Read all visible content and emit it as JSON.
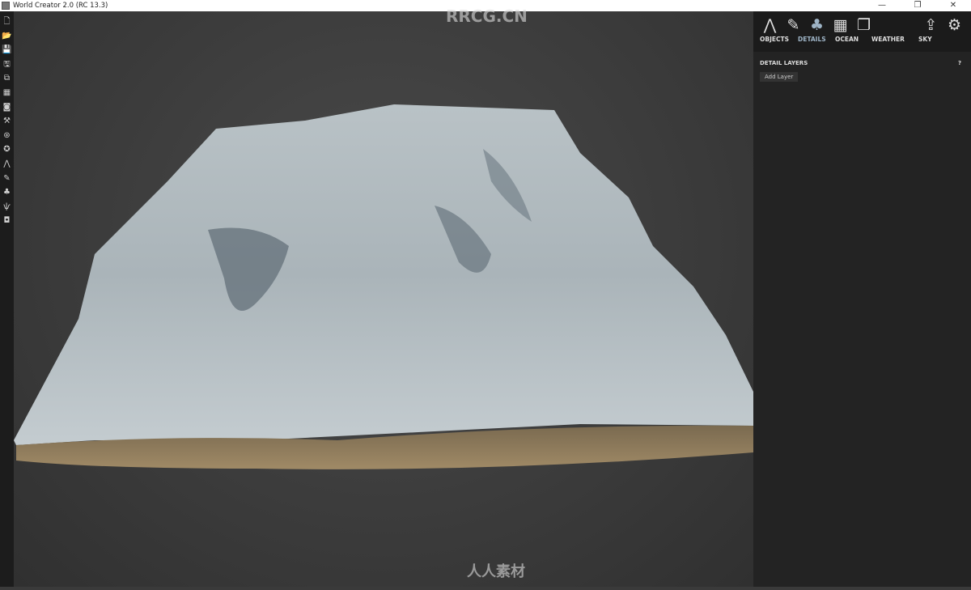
{
  "window": {
    "title": "World Creator 2.0 (RC 13.3)",
    "minimize": "—",
    "restore": "❐",
    "close": "✕"
  },
  "left_toolbar": [
    {
      "icon": "new-file-icon",
      "glyph": "🗋"
    },
    {
      "icon": "open-folder-icon",
      "glyph": "📂"
    },
    {
      "icon": "save-icon",
      "glyph": "💾"
    },
    {
      "icon": "save-as-icon",
      "glyph": "🖫"
    },
    {
      "icon": "import-icon",
      "glyph": "⧉"
    },
    {
      "icon": "map-icon",
      "glyph": "▦"
    },
    {
      "icon": "binoculars-icon",
      "glyph": "◙"
    },
    {
      "icon": "paint-brush-icon",
      "glyph": "⚒"
    },
    {
      "icon": "globe-icon",
      "glyph": "⊛"
    },
    {
      "icon": "star-icon",
      "glyph": "✪"
    },
    {
      "icon": "mountain-icon",
      "glyph": "⋀"
    },
    {
      "icon": "brush-icon",
      "glyph": "✎"
    },
    {
      "icon": "trees-icon",
      "glyph": "♣"
    },
    {
      "icon": "grass-icon",
      "glyph": "ѱ"
    },
    {
      "icon": "camera-icon",
      "glyph": "◘"
    }
  ],
  "panel": {
    "icons": [
      {
        "name": "terrain-icon",
        "glyph": "⋀"
      },
      {
        "name": "brush-icon",
        "glyph": "✎"
      },
      {
        "name": "trees-icon",
        "glyph": "♣",
        "active": true
      },
      {
        "name": "map-icon",
        "glyph": "▦"
      },
      {
        "name": "layers-icon",
        "glyph": "❐"
      }
    ],
    "right_icons": [
      {
        "name": "export-icon",
        "glyph": "⇪"
      },
      {
        "name": "gear-icon",
        "glyph": "⚙"
      }
    ],
    "tabs": [
      "OBJECTS",
      "DETAILS",
      "OCEAN",
      "WEATHER",
      "SKY"
    ],
    "active_tab": "DETAILS",
    "section_title": "DETAIL LAYERS",
    "help": "?",
    "add_layer": "Add Layer"
  },
  "watermarks": {
    "top": "RRCG.CN",
    "bottom": "人人素材"
  },
  "colors": {
    "accent": "#9eb4c6",
    "panel": "#232323"
  }
}
